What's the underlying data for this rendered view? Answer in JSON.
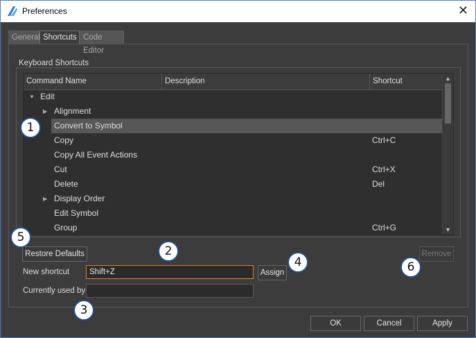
{
  "window": {
    "title": "Preferences",
    "close_label": "✕",
    "accent_color": "#e8821e"
  },
  "tabs": [
    {
      "label": "General",
      "active": false
    },
    {
      "label": "Shortcuts",
      "active": true
    },
    {
      "label": "Code Editor",
      "active": false
    }
  ],
  "shortcuts": {
    "group_label": "Keyboard Shortcuts",
    "columns": [
      "Command Name",
      "Description",
      "Shortcut"
    ],
    "rows": [
      {
        "name": "Edit",
        "shortcut": "",
        "level": 0,
        "expander": "expanded"
      },
      {
        "name": "Alignment",
        "shortcut": "",
        "level": 1,
        "expander": "collapsed"
      },
      {
        "name": "Convert to Symbol",
        "shortcut": "",
        "level": 1,
        "expander": "none",
        "selected": true
      },
      {
        "name": "Copy",
        "shortcut": "Ctrl+C",
        "level": 1,
        "expander": "none"
      },
      {
        "name": "Copy All Event Actions",
        "shortcut": "",
        "level": 1,
        "expander": "none"
      },
      {
        "name": "Cut",
        "shortcut": "Ctrl+X",
        "level": 1,
        "expander": "none"
      },
      {
        "name": "Delete",
        "shortcut": "Del",
        "level": 1,
        "expander": "none"
      },
      {
        "name": "Display Order",
        "shortcut": "",
        "level": 1,
        "expander": "collapsed"
      },
      {
        "name": "Edit Symbol",
        "shortcut": "",
        "level": 1,
        "expander": "none"
      },
      {
        "name": "Group",
        "shortcut": "Ctrl+G",
        "level": 1,
        "expander": "none"
      }
    ],
    "restore_defaults_label": "Restore Defaults",
    "new_shortcut_label": "New shortcut",
    "new_shortcut_value": "Shift+Z",
    "assign_label": "Assign",
    "currently_used_by_label": "Currently used by",
    "currently_used_by_value": "",
    "remove_label": "Remove"
  },
  "footer": {
    "ok_label": "OK",
    "cancel_label": "Cancel",
    "apply_label": "Apply"
  },
  "callouts": [
    "1",
    "2",
    "3",
    "4",
    "5",
    "6"
  ]
}
